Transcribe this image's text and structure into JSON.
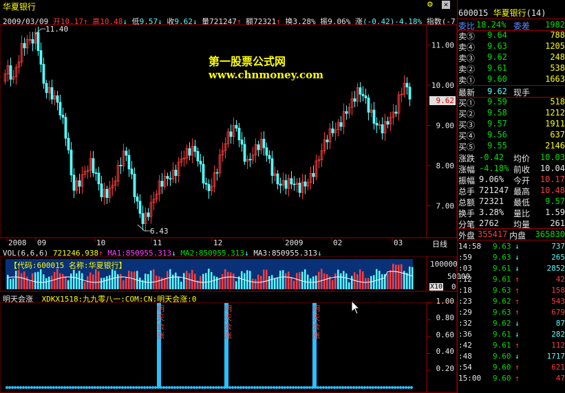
{
  "colors": {
    "up": "#ff3c3c",
    "down": "#54ffff",
    "bg": "#000000",
    "frame": "#a00000",
    "text": "#c0c0c0",
    "yellow": "#ffff00",
    "ma1": "#ff40ff",
    "ma2": "#00e000",
    "ma3": "#e8e8e8",
    "signal": "#28c0ff"
  },
  "header": {
    "stock_name": "华夏银行",
    "date": "2009/03/09",
    "open_label": "开",
    "open": "10.17",
    "high_label": "高",
    "high": "10.48",
    "low_label": "低",
    "low": "9.57",
    "close_label": "收",
    "close": "9.62",
    "vol_label": "量",
    "vol": "721247",
    "amount_label": "额",
    "amount": "72321",
    "turnover_label": "换",
    "turnover": "3.28%",
    "amplitude_label": "振",
    "amplitude": "9.06%",
    "change_label": "涨",
    "change": "(-0.42)-4.18%",
    "index_label": "指数",
    "index_tail": "(-7"
  },
  "icons": {
    "settings": "gear-icon",
    "close": "close-icon"
  },
  "watermark": {
    "title": "第一股票公式网",
    "url": "www.chnmoney.com"
  },
  "price_chart": {
    "max_label": "11.40",
    "min_label": "6.43",
    "current_price_tag": "9.62",
    "y_ticks": [
      "11.00",
      "10.00",
      "9.00",
      "8.00",
      "7.00"
    ],
    "x_labels": [
      "2008",
      "09",
      "10",
      "11",
      "12",
      "2009",
      "02",
      "03"
    ],
    "period": "日线"
  },
  "volume": {
    "title": "VOL(6,6,6)",
    "vol_value": "721246.938",
    "ma1_label": "MA1:",
    "ma1_value": "850955.313",
    "ma2_label": "MA2:",
    "ma2_value": "850955.313",
    "ma3_label": "MA3:",
    "ma3_value": "850955.313",
    "y_ticks": [
      "100000",
      "50000",
      "0"
    ],
    "unit": "X10",
    "banner": "【代码:600015 名称:华夏银行】"
  },
  "indicator": {
    "name": "明天会涨",
    "formula": "XDKX1518:九九零八一:COM:CN:明天会涨:0",
    "y_ticks": [
      "1.00",
      "0.80",
      "0.60",
      "0.40",
      "0.20"
    ],
    "signal_text": "明天会涨"
  },
  "quote_panel": {
    "code": "600015",
    "name": "华夏银行",
    "count": "(14)",
    "ratio_label": "委比",
    "ratio": "18.24%",
    "diff_label": "委差",
    "diff": "1982",
    "asks": [
      {
        "label": "卖⑤",
        "price": "9.64",
        "vol": "788"
      },
      {
        "label": "卖④",
        "price": "9.63",
        "vol": "1205"
      },
      {
        "label": "卖③",
        "price": "9.62",
        "vol": "248"
      },
      {
        "label": "卖②",
        "price": "9.61",
        "vol": "538"
      },
      {
        "label": "卖①",
        "price": "9.60",
        "vol": "1663"
      }
    ],
    "last_label": "最新",
    "last": "9.62",
    "hand_label": "现手",
    "hand": "",
    "bids": [
      {
        "label": "买①",
        "price": "9.59",
        "vol": "518"
      },
      {
        "label": "买②",
        "price": "9.58",
        "vol": "1212"
      },
      {
        "label": "买③",
        "price": "9.57",
        "vol": "1911"
      },
      {
        "label": "买④",
        "price": "9.56",
        "vol": "637"
      },
      {
        "label": "买⑤",
        "price": "9.55",
        "vol": "2146"
      }
    ],
    "stats": [
      {
        "l1": "涨跌",
        "v1": "-0.42",
        "l2": "均价",
        "v2": "10.03"
      },
      {
        "l1": "涨幅",
        "v1": "-4.18%",
        "l2": "前收",
        "v2": "10.04"
      },
      {
        "l1": "振幅",
        "v1": "9.06%",
        "l2": "今开",
        "v2": "10.17"
      },
      {
        "l1": "总手",
        "v1": "721247",
        "l2": "最高",
        "v2": "10.48"
      },
      {
        "l1": "总额",
        "v1": "72321",
        "l2": "最低",
        "v2": "9.57"
      },
      {
        "l1": "换手",
        "v1": "3.28%",
        "l2": "量比",
        "v2": "1.59"
      },
      {
        "l1": "分笔",
        "v1": "2762",
        "l2": "均量",
        "v2": "261"
      }
    ],
    "outer_label": "外盘",
    "outer": "355417",
    "inner_label": "内盘",
    "inner": "365830"
  },
  "ticks": [
    {
      "time": "14:58",
      "price": "9.63",
      "vol": "737",
      "dir": "down"
    },
    {
      "time": ":59",
      "price": "9.63",
      "vol": "265",
      "dir": "down"
    },
    {
      "time": ":03",
      "price": "9.61",
      "vol": "2852",
      "dir": "down"
    },
    {
      "time": ":12",
      "price": "9.61",
      "vol": "42",
      "dir": "up"
    },
    {
      "time": ":18",
      "price": "9.63",
      "vol": "158",
      "dir": "up"
    },
    {
      "time": ":23",
      "price": "9.62",
      "vol": "543",
      "dir": "up"
    },
    {
      "time": ":29",
      "price": "9.63",
      "vol": "679",
      "dir": "up"
    },
    {
      "time": ":32",
      "price": "9.62",
      "vol": "87",
      "dir": "down"
    },
    {
      "time": ":36",
      "price": "9.61",
      "vol": "282",
      "dir": "down"
    },
    {
      "time": ":42",
      "price": "9.61",
      "vol": "112",
      "dir": "up"
    },
    {
      "time": ":48",
      "price": "9.60",
      "vol": "1717",
      "dir": "down"
    },
    {
      "time": ":54",
      "price": "9.60",
      "vol": "621",
      "dir": "up"
    },
    {
      "time": "15:00",
      "price": "9.60",
      "vol": "47",
      "dir": "up"
    }
  ]
}
